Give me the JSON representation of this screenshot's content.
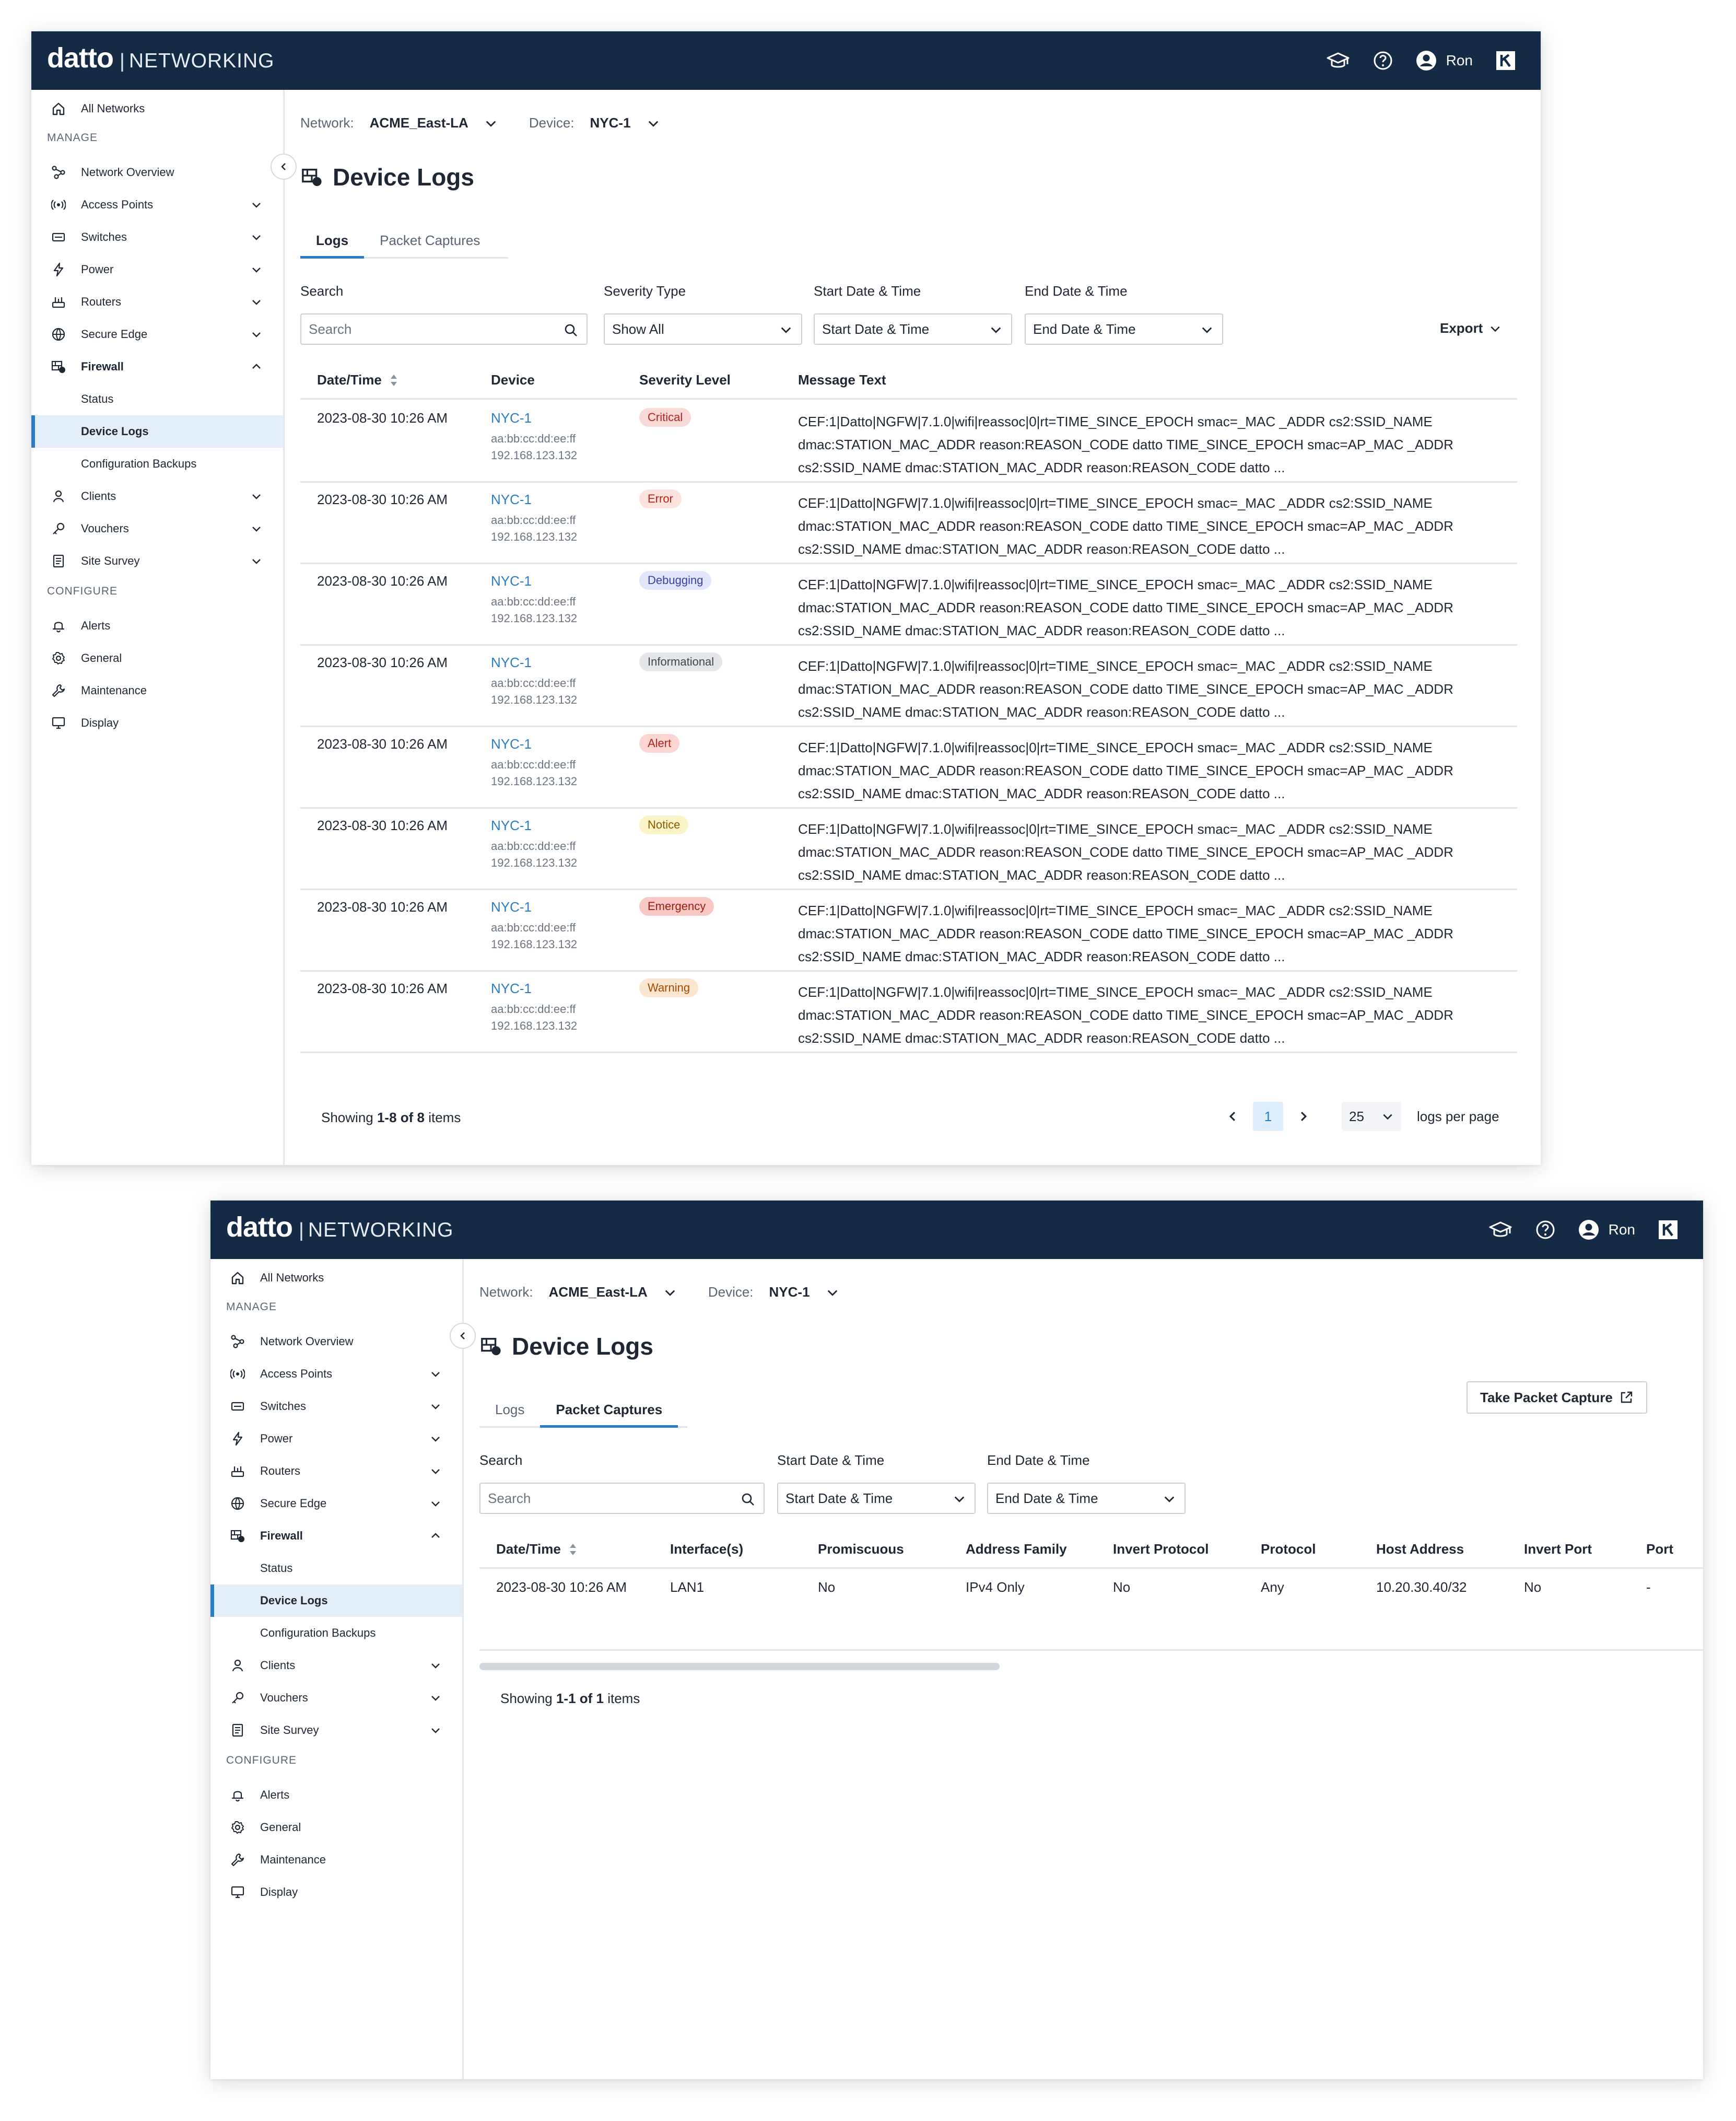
{
  "brand": {
    "name": "datto",
    "separator": "|",
    "product": "NETWORKING"
  },
  "topbar": {
    "user_name": "Ron",
    "icons": [
      "graduation-cap-icon",
      "help-icon",
      "user-avatar-icon",
      "kaseya-logo-icon"
    ]
  },
  "sidebar": {
    "all_networks": "All Networks",
    "manage_label": "MANAGE",
    "configure_label": "CONFIGURE",
    "items": [
      {
        "label": "Network Overview",
        "icon": "network-overview-icon"
      },
      {
        "label": "Access Points",
        "icon": "access-point-icon"
      },
      {
        "label": "Switches",
        "icon": "switch-icon"
      },
      {
        "label": "Power",
        "icon": "power-icon"
      },
      {
        "label": "Routers",
        "icon": "router-icon"
      },
      {
        "label": "Secure Edge",
        "icon": "secure-edge-icon"
      },
      {
        "label": "Firewall",
        "icon": "firewall-icon"
      }
    ],
    "firewall_sub": [
      "Status",
      "Device Logs",
      "Configuration Backups"
    ],
    "items2": [
      {
        "label": "Clients",
        "icon": "client-icon"
      },
      {
        "label": "Vouchers",
        "icon": "voucher-icon"
      },
      {
        "label": "Site Survey",
        "icon": "site-survey-icon"
      }
    ],
    "configure": [
      {
        "label": "Alerts",
        "icon": "bell-icon"
      },
      {
        "label": "General",
        "icon": "gear-icon"
      },
      {
        "label": "Maintenance",
        "icon": "wrench-icon"
      },
      {
        "label": "Display",
        "icon": "monitor-icon"
      }
    ]
  },
  "picker": {
    "network_label": "Network:",
    "network_value": "ACME_East-LA",
    "device_label": "Device:",
    "device_value": "NYC-1"
  },
  "page_title": "Device Logs",
  "tabs": [
    "Logs",
    "Packet Captures"
  ],
  "logs_view": {
    "filters": {
      "search_label": "Search",
      "search_placeholder": "Search",
      "severity_label": "Severity Type",
      "severity_value": "Show All",
      "start_label": "Start Date & Time",
      "start_placeholder": "Start Date & Time",
      "end_label": "End Date & Time",
      "end_placeholder": "End Date & Time"
    },
    "export_label": "Export",
    "columns": [
      "Date/Time",
      "Device",
      "Severity Level",
      "Message Text"
    ],
    "rows": [
      {
        "date": "2023-08-30 10:26 AM",
        "device": "NYC-1",
        "mac": "aa:bb:cc:dd:ee:ff",
        "ip": "192.168.123.132",
        "severity": "Critical"
      },
      {
        "date": "2023-08-30 10:26 AM",
        "device": "NYC-1",
        "mac": "aa:bb:cc:dd:ee:ff",
        "ip": "192.168.123.132",
        "severity": "Error"
      },
      {
        "date": "2023-08-30 10:26 AM",
        "device": "NYC-1",
        "mac": "aa:bb:cc:dd:ee:ff",
        "ip": "192.168.123.132",
        "severity": "Debugging"
      },
      {
        "date": "2023-08-30 10:26 AM",
        "device": "NYC-1",
        "mac": "aa:bb:cc:dd:ee:ff",
        "ip": "192.168.123.132",
        "severity": "Informational"
      },
      {
        "date": "2023-08-30 10:26 AM",
        "device": "NYC-1",
        "mac": "aa:bb:cc:dd:ee:ff",
        "ip": "192.168.123.132",
        "severity": "Alert"
      },
      {
        "date": "2023-08-30 10:26 AM",
        "device": "NYC-1",
        "mac": "aa:bb:cc:dd:ee:ff",
        "ip": "192.168.123.132",
        "severity": "Notice"
      },
      {
        "date": "2023-08-30 10:26 AM",
        "device": "NYC-1",
        "mac": "aa:bb:cc:dd:ee:ff",
        "ip": "192.168.123.132",
        "severity": "Emergency"
      },
      {
        "date": "2023-08-30 10:26 AM",
        "device": "NYC-1",
        "mac": "aa:bb:cc:dd:ee:ff",
        "ip": "192.168.123.132",
        "severity": "Warning"
      }
    ],
    "message_lines": [
      "CEF:1|Datto|NGFW|7.1.0|wifi|reassoc|0|rt=TIME_SINCE_EPOCH smac=_MAC _ADDR cs2:SSID_NAME",
      "dmac:STATION_MAC_ADDR reason:REASON_CODE datto TIME_SINCE_EPOCH smac=AP_MAC _ADDR",
      "cs2:SSID_NAME dmac:STATION_MAC_ADDR reason:REASON_CODE datto ..."
    ],
    "severity_colors": {
      "Critical": {
        "bg": "#f9d9d6",
        "fg": "#b42318"
      },
      "Error": {
        "bg": "#fde3dc",
        "fg": "#b42318"
      },
      "Debugging": {
        "bg": "#e3e6fb",
        "fg": "#3442a8"
      },
      "Informational": {
        "bg": "#e4e6e9",
        "fg": "#3d4652"
      },
      "Alert": {
        "bg": "#fbd5d2",
        "fg": "#b42318"
      },
      "Notice": {
        "bg": "#fdf3c8",
        "fg": "#8a5a00"
      },
      "Emergency": {
        "bg": "#f8c9c4",
        "fg": "#a01a12"
      },
      "Warning": {
        "bg": "#fde6cf",
        "fg": "#a24b00"
      }
    },
    "footer": {
      "showing_prefix": "Showing ",
      "range": "1-8 of 8",
      "suffix": " items",
      "page": "1",
      "per_page": "25",
      "per_page_label": "logs per page"
    }
  },
  "captures_view": {
    "take_capture_label": "Take Packet Capture",
    "filters": {
      "search_label": "Search",
      "search_placeholder": "Search",
      "start_label": "Start Date & Time",
      "start_placeholder": "Start Date & Time",
      "end_label": "End Date & Time",
      "end_placeholder": "End Date & Time"
    },
    "columns": [
      "Date/Time",
      "Interface(s)",
      "Promiscuous",
      "Address Family",
      "Invert Protocol",
      "Protocol",
      "Host Address",
      "Invert Port",
      "Port"
    ],
    "rows": [
      [
        "2023-08-30 10:26 AM",
        "LAN1",
        "No",
        "IPv4 Only",
        "No",
        "Any",
        "10.20.30.40/32",
        "No",
        "-"
      ]
    ],
    "footer": {
      "showing_prefix": "Showing ",
      "range": "1-1 of 1",
      "suffix": " items"
    }
  }
}
